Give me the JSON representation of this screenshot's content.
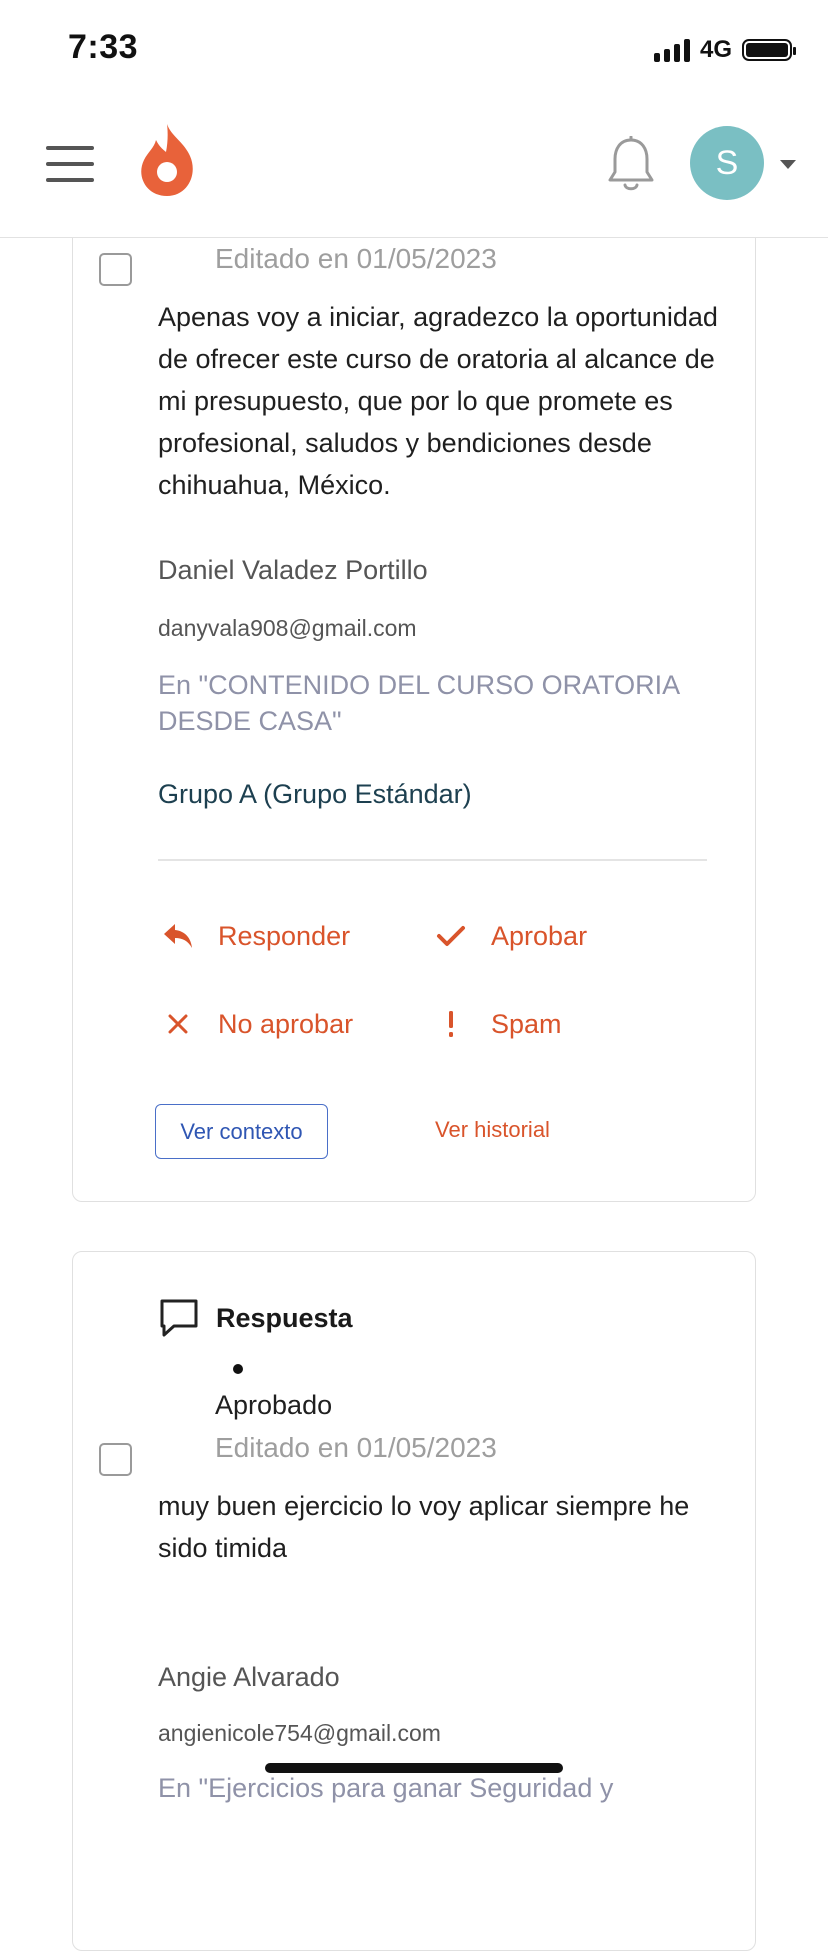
{
  "status_bar": {
    "time": "7:33",
    "network": "4G"
  },
  "header": {
    "avatar_initial": "S",
    "brand_color": "#e8623a"
  },
  "comments": [
    {
      "edited": "Editado en 01/05/2023",
      "text": "Apenas voy a iniciar, agradezco la oportunidad de ofrecer este curso de oratoria al alcance de mi presupuesto, que por lo que promete es profesional, saludos y bendiciones desde chihuahua, México.",
      "author": "Daniel Valadez Portillo",
      "email": "danyvala908@gmail.com",
      "course": "En \"CONTENIDO DEL CURSO ORATORIA DESDE CASA\"",
      "group": "Grupo A (Grupo Estándar)",
      "actions": {
        "reply": "Responder",
        "approve": "Aprobar",
        "reject": "No aprobar",
        "spam": "Spam"
      },
      "view_context": "Ver contexto",
      "view_history": "Ver historial"
    },
    {
      "type_label": "Respuesta",
      "status": "Aprobado",
      "edited": "Editado en 01/05/2023",
      "text": "muy buen ejercicio lo voy aplicar siempre he sido timida",
      "author": "Angie Alvarado",
      "email": "angienicole754@gmail.com",
      "course": "En \"Ejercicios para ganar Seguridad y"
    }
  ],
  "colors": {
    "action": "#d9542b",
    "avatar_bg": "#7abfc3",
    "context_button": "#4a6fc8",
    "course_text": "#8f92a8",
    "group_text": "#1d4050"
  }
}
